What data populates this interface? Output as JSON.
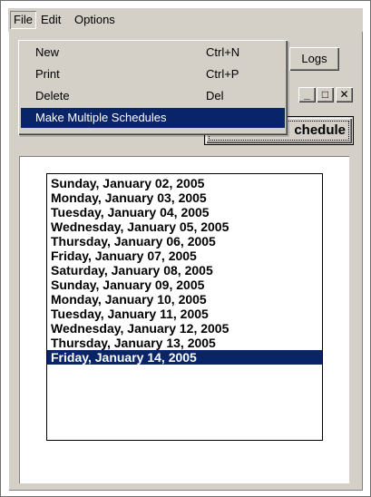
{
  "menubar": {
    "items": [
      {
        "label": "File"
      },
      {
        "label": "Edit"
      },
      {
        "label": "Options"
      }
    ]
  },
  "file_menu": {
    "items": [
      {
        "label": "New",
        "shortcut": "Ctrl+N"
      },
      {
        "label": "Print",
        "shortcut": "Ctrl+P"
      },
      {
        "label": "Delete",
        "shortcut": "Del"
      },
      {
        "label": "Make Multiple Schedules",
        "shortcut": ""
      }
    ],
    "highlighted_index": 3
  },
  "tabs": {
    "logs_label": "Logs"
  },
  "window_controls": {
    "minimize": "_",
    "maximize": "□",
    "close": "✕"
  },
  "schedule_button": {
    "label": "chedule"
  },
  "dates": {
    "items": [
      "Sunday, January 02, 2005",
      "Monday, January 03, 2005",
      "Tuesday, January 04, 2005",
      "Wednesday, January 05, 2005",
      "Thursday, January 06, 2005",
      "Friday, January 07, 2005",
      "Saturday, January 08, 2005",
      "Sunday, January 09, 2005",
      "Monday, January 10, 2005",
      "Tuesday, January 11, 2005",
      "Wednesday, January 12, 2005",
      "Thursday, January 13, 2005",
      "Friday, January 14, 2005"
    ],
    "selected_index": 12
  },
  "colors": {
    "face": "#d4d0c8",
    "highlight": "#0a246a",
    "highlight_text": "#ffffff"
  }
}
